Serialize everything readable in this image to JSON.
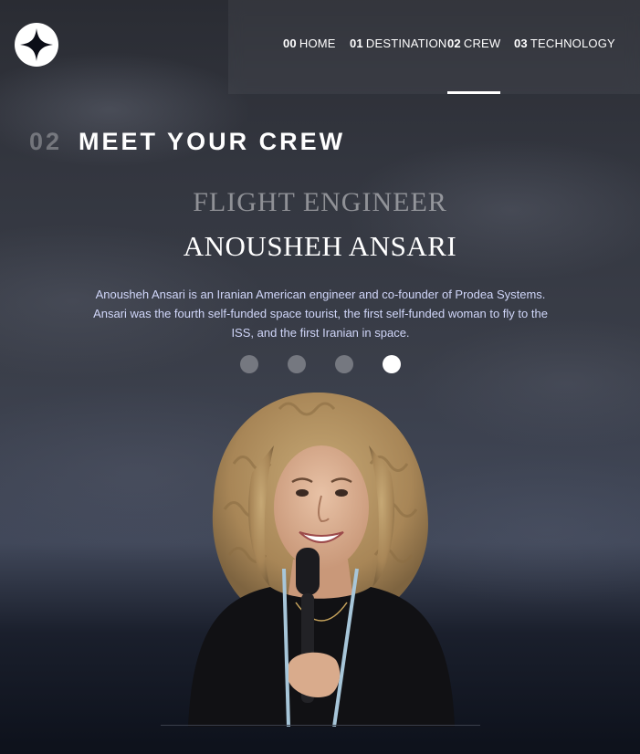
{
  "header": {
    "logo_icon": "star-icon",
    "nav": [
      {
        "num": "00",
        "label": "HOME",
        "active": false
      },
      {
        "num": "01",
        "label": "DESTINATION",
        "active": false
      },
      {
        "num": "02",
        "label": "CREW",
        "active": true
      },
      {
        "num": "03",
        "label": "TECHNOLOGY",
        "active": false
      }
    ]
  },
  "section": {
    "num": "02",
    "title": "MEET YOUR CREW"
  },
  "crew": {
    "role": "FLIGHT ENGINEER",
    "name": "ANOUSHEH ANSARI",
    "bio": "Anousheh Ansari is an Iranian American engineer and co-founder of Prodea Systems. Ansari was the fourth self-funded space tourist, the first self-funded woman to fly to the ISS, and the first Iranian in space.",
    "total_members": 4,
    "active_index": 3
  },
  "colors": {
    "accent": "#ffffff",
    "bio_text": "#d0d6f9",
    "background": "#0b0d17"
  }
}
